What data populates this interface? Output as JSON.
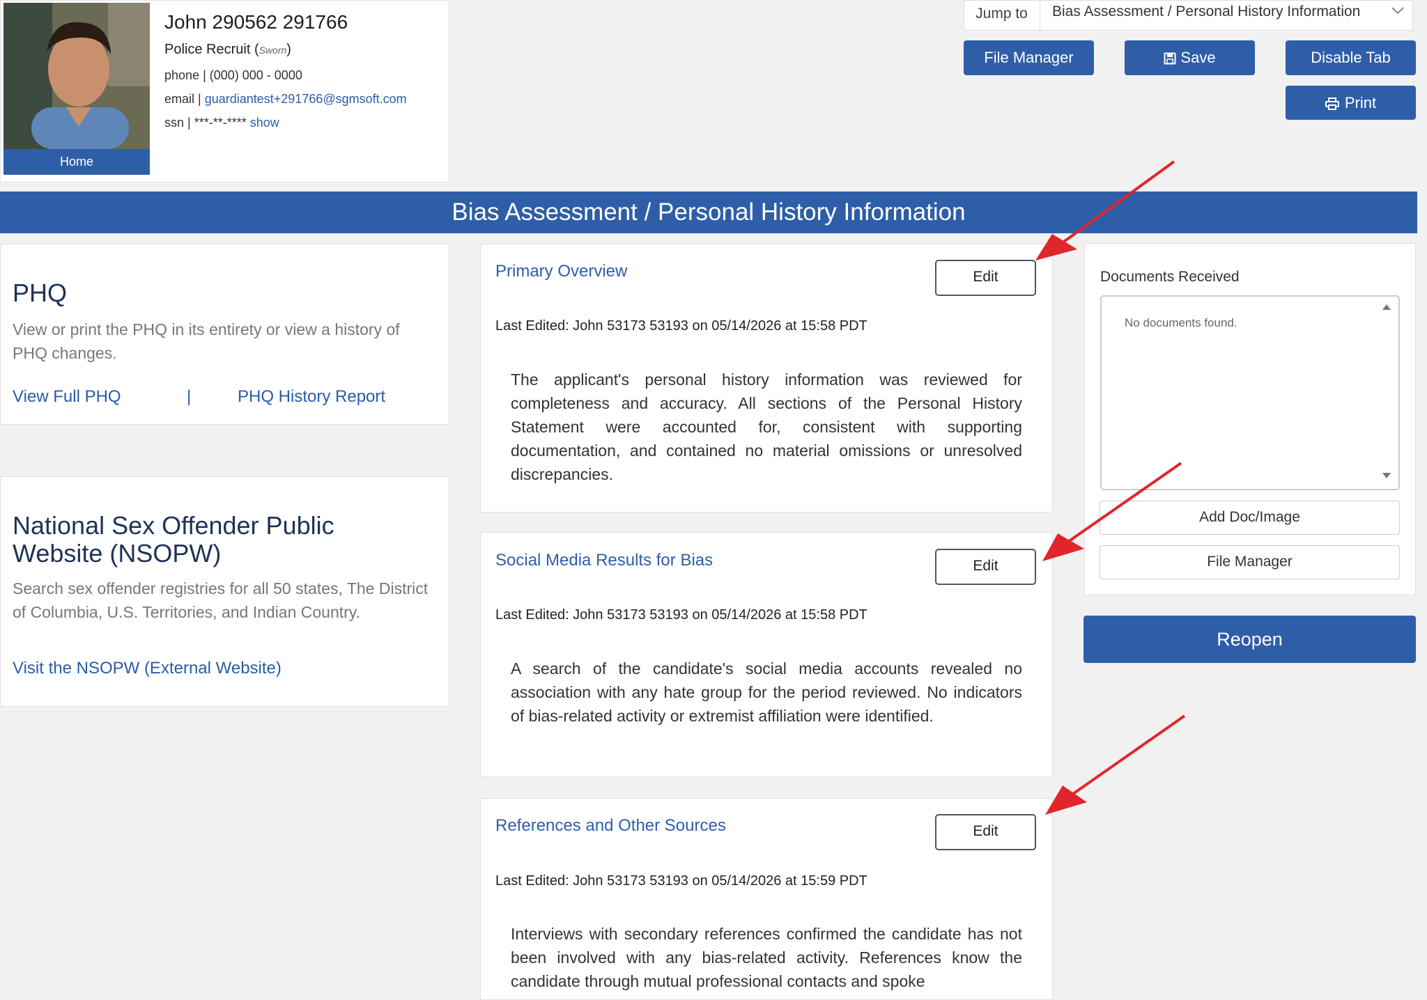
{
  "profile": {
    "name": "John 290562 291766",
    "title": "Police Recruit",
    "title_tag": "Sworn",
    "phone_label": "phone",
    "phone": "(000) 000 - 0000",
    "email_label": "email",
    "email": "guardiantest+291766@sgmsoft.com",
    "ssn_label": "ssn",
    "ssn": "***-**-****",
    "ssn_show": "show",
    "home_label": "Home"
  },
  "toolbar": {
    "jump_label": "Jump to",
    "jump_value": "Bias Assessment / Personal History Information",
    "file_manager": "File Manager",
    "save": "Save",
    "disable_tab": "Disable Tab",
    "print": "Print"
  },
  "banner": {
    "title": "Bias Assessment / Personal History Information"
  },
  "phq": {
    "title": "PHQ",
    "desc": "View or print the PHQ in its entirety or view a history of PHQ changes.",
    "link_full": "View Full PHQ",
    "separator": "|",
    "link_history": "PHQ History Report"
  },
  "nsopw": {
    "title": "National Sex Offender Public Website (NSOPW)",
    "desc": "Search sex offender registries for all 50 states, The District of Columbia, U.S. Territories, and Indian Country.",
    "link": "Visit the NSOPW (External Website)"
  },
  "sections": [
    {
      "title": "Primary Overview",
      "edit": "Edit",
      "last_edited": "Last Edited: John 53173 53193 on 05/14/2026 at 15:58 PDT",
      "body": "The applicant's personal history information was reviewed for completeness and accuracy. All sections of the Personal History Statement were accounted for, consistent with supporting documentation, and contained no material omissions or unresolved discrepancies."
    },
    {
      "title": "Social Media Results for Bias",
      "edit": "Edit",
      "last_edited": "Last Edited: John 53173 53193 on 05/14/2026 at 15:58 PDT",
      "body": "A search of the candidate's social media accounts revealed no association with any hate group for the period reviewed. No indicators of bias-related activity or extremist affiliation were identified."
    },
    {
      "title": "References and Other Sources",
      "edit": "Edit",
      "last_edited": "Last Edited: John 53173 53193 on 05/14/2026 at 15:59 PDT",
      "body": "Interviews with secondary references confirmed the candidate has not been involved with any bias-related activity. References know the candidate through mutual professional contacts and spoke"
    }
  ],
  "documents": {
    "title": "Documents Received",
    "empty": "No documents found.",
    "add": "Add Doc/Image",
    "file_manager": "File Manager"
  },
  "reopen": "Reopen",
  "colors": {
    "primary": "#2f5ea8",
    "arrow": "#e0262b",
    "link": "#2a5ca8"
  },
  "icons": [
    "save-icon",
    "print-icon",
    "chevron-down-icon",
    "scroll-up-icon",
    "scroll-down-icon"
  ]
}
